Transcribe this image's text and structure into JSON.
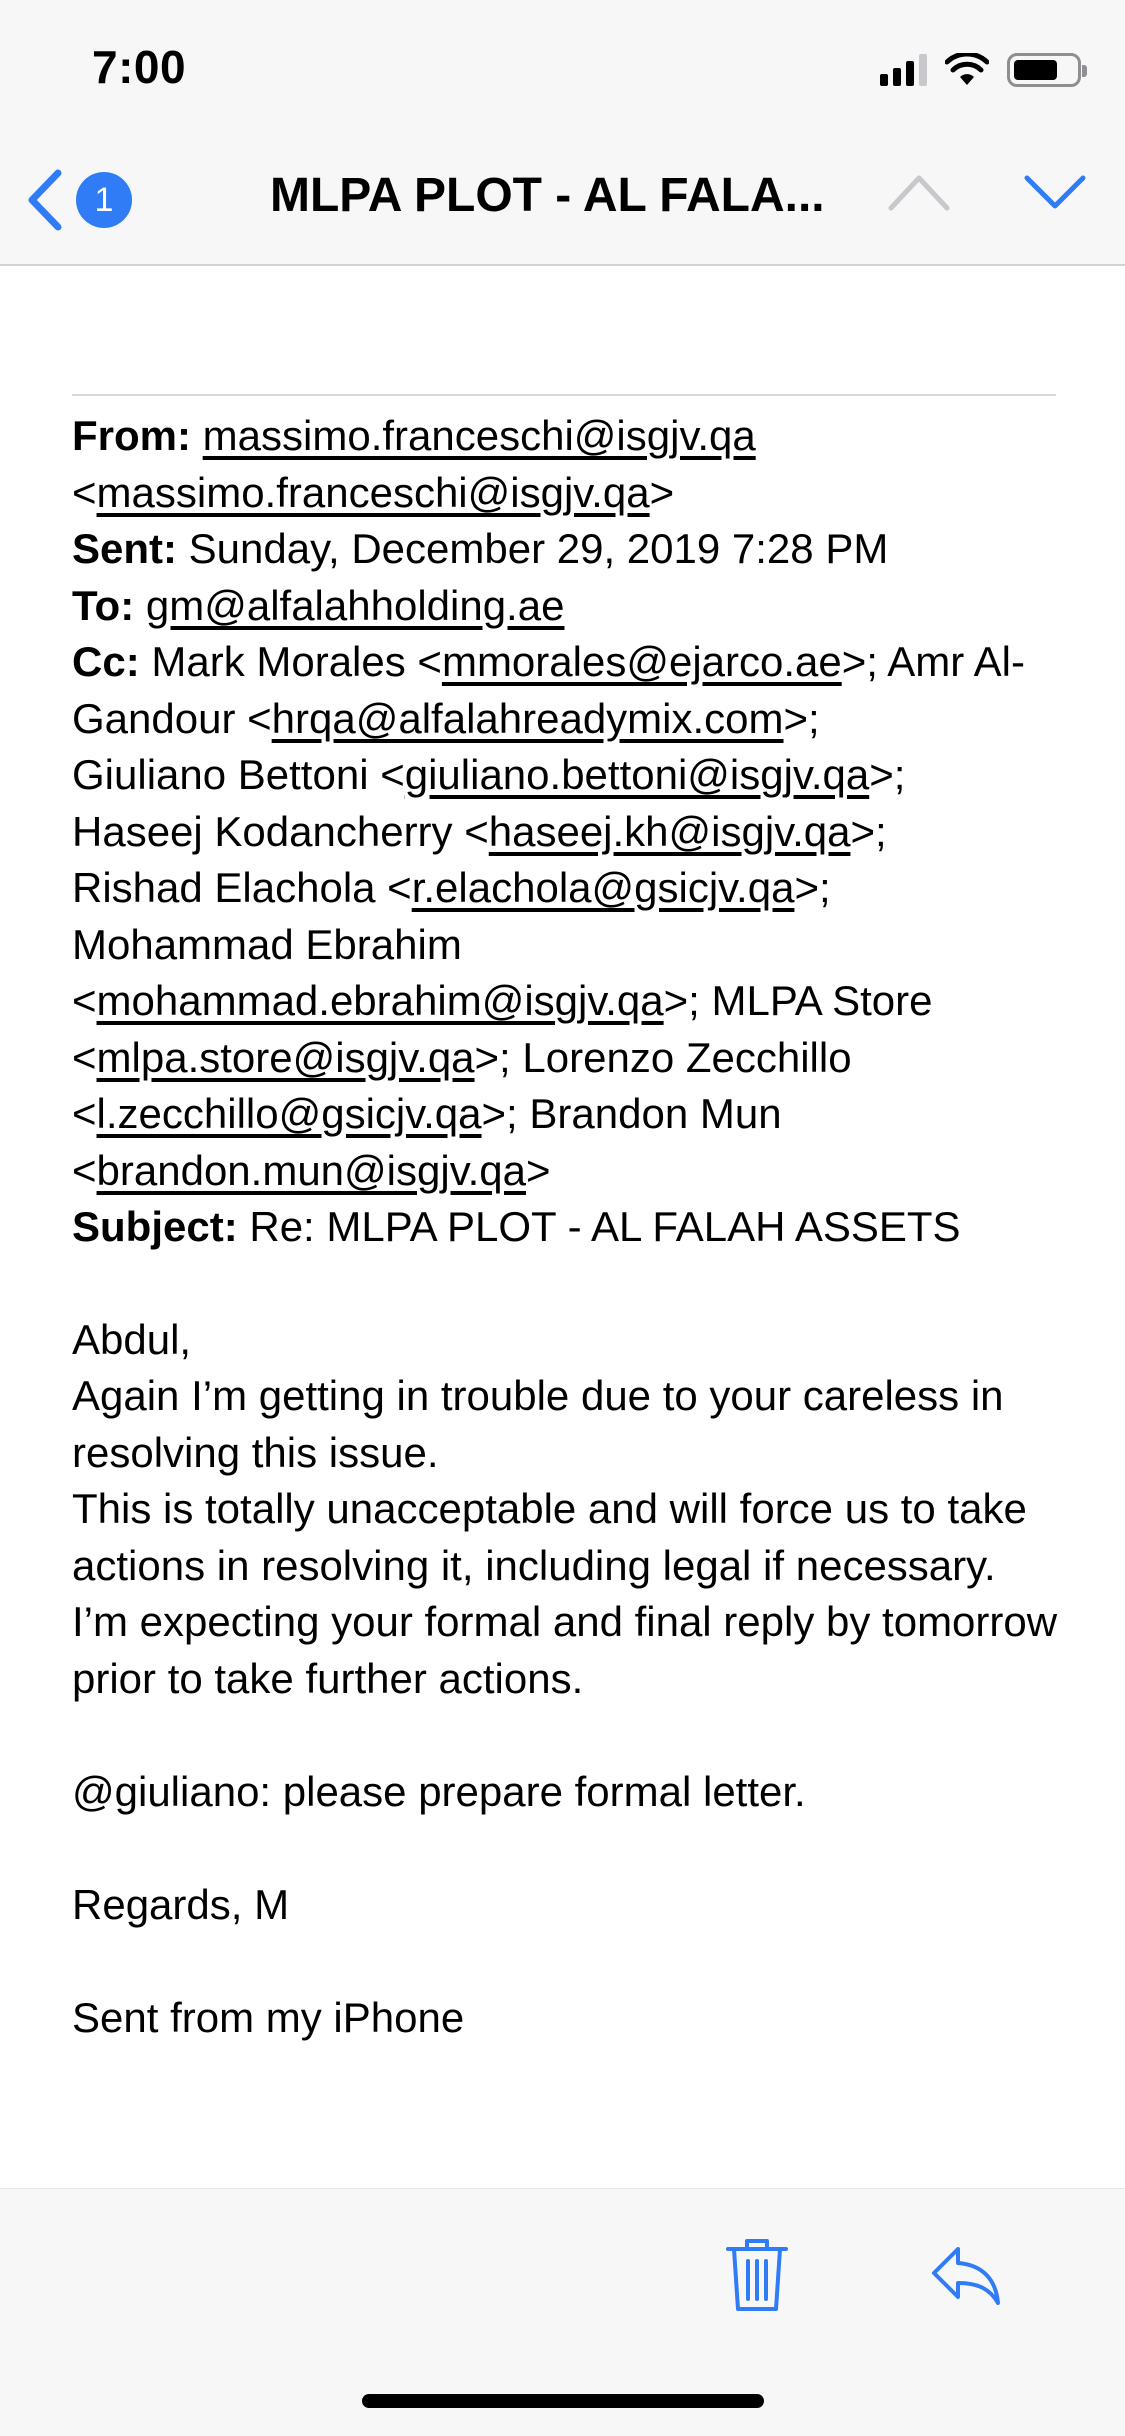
{
  "status_bar": {
    "time": "7:00"
  },
  "nav": {
    "unread_count": "1",
    "title": "MLPA PLOT - AL FALA..."
  },
  "email": {
    "from_label": "From:",
    "from_email": "massimo.franceschi@isgjv.qa",
    "from_email_bracketed": "massimo.franceschi@isgjv.qa",
    "sent_label": "Sent:",
    "sent_value": "Sunday, December 29, 2019 7:28 PM",
    "to_label": "To:",
    "to_email": "gm@alfalahholding.ae",
    "cc_label": "Cc:",
    "cc": [
      {
        "name": "Mark Morales",
        "email": "mmorales@ejarco.ae"
      },
      {
        "name": "Amr Al-Gandour",
        "email": "hrqa@alfalahreadymix.com"
      },
      {
        "name": "Giuliano Bettoni",
        "email": "giuliano.bettoni@isgjv.qa"
      },
      {
        "name": "Haseej Kodancherry",
        "email": "haseej.kh@isgjv.qa"
      },
      {
        "name": "Rishad Elachola",
        "email": "r.elachola@gsicjv.qa"
      },
      {
        "name": "Mohammad Ebrahim",
        "email": "mohammad.ebrahim@isgjv.qa"
      },
      {
        "name": "MLPA Store",
        "email": "mlpa.store@isgjv.qa"
      },
      {
        "name": "Lorenzo Zecchillo",
        "email": "l.zecchillo@gsicjv.qa"
      },
      {
        "name": "Brandon Mun",
        "email": "brandon.mun@isgjv.qa"
      }
    ],
    "subject_label": "Subject:",
    "subject_value": "Re: MLPA PLOT - AL FALAH ASSETS",
    "body": {
      "greeting": "Abdul,",
      "p1": "Again I’m getting in trouble due to your careless in resolving this issue.",
      "p2": "This is totally unacceptable and will force us to take actions in resolving it, including legal if necessary.",
      "p3": "I’m expecting your formal and final reply by tomorrow prior to take further actions.",
      "p4": "@giuliano: please prepare formal letter.",
      "signoff": "Regards, M",
      "signature": "Sent from my iPhone"
    }
  },
  "colors": {
    "accent": "#2f7cf6",
    "chrome_bg": "#f7f7f8"
  },
  "icons": [
    "back-chevron-icon",
    "previous-message-icon",
    "next-message-icon",
    "trash-icon",
    "reply-icon",
    "wifi-icon",
    "battery-icon",
    "signal-icon"
  ]
}
